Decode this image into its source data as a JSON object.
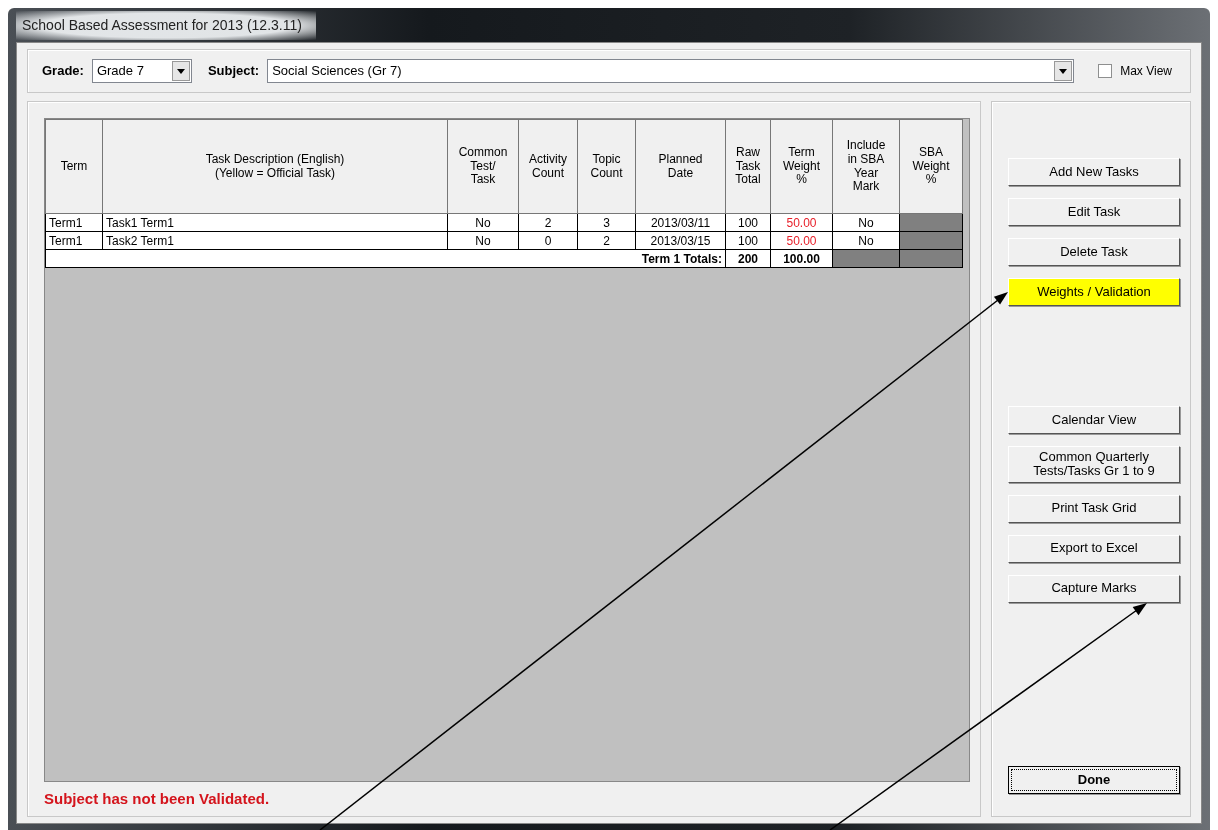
{
  "window": {
    "title": "School Based Assessment for 2013 (12.3.11)"
  },
  "filters": {
    "grade_label": "Grade:",
    "grade": "Grade 7",
    "subject_label": "Subject:",
    "subject": "Social Sciences (Gr 7)",
    "max_view": {
      "label": "Max View",
      "checked": false
    }
  },
  "table": {
    "columns": [
      "Term",
      "Task Description (English)\n(Yellow = Official Task)",
      "Common\nTest/\nTask",
      "Activity\nCount",
      "Topic\nCount",
      "Planned\nDate",
      "Raw\nTask\nTotal",
      "Term\nWeight\n%",
      "Include\nin SBA\nYear\nMark",
      "SBA\nWeight\n%"
    ],
    "rows": [
      {
        "cells": [
          "Term1",
          "Task1 Term1",
          "No",
          "2",
          "3",
          "2013/03/11",
          "100",
          "50.00",
          "No"
        ],
        "weight_flagged": true
      },
      {
        "cells": [
          "Term1",
          "Task2 Term1",
          "No",
          "0",
          "2",
          "2013/03/15",
          "100",
          "50.00",
          "No"
        ],
        "weight_flagged": true
      }
    ],
    "totals": {
      "label": "Term 1 Totals:",
      "raw_total": "200",
      "term_weight": "100.00"
    }
  },
  "status": "Subject has not been Validated.",
  "button_groups": [
    [
      {
        "label": "Add New Tasks",
        "highlighted": false,
        "default": false
      },
      {
        "label": "Edit Task",
        "highlighted": false,
        "default": false
      },
      {
        "label": "Delete Task",
        "highlighted": false,
        "default": false
      },
      {
        "label": "Weights / Validation",
        "highlighted": true,
        "default": false
      }
    ],
    [
      {
        "label": "Calendar View",
        "highlighted": false,
        "default": false
      },
      {
        "label": "Common Quarterly\nTests/Tasks Gr 1 to 9",
        "highlighted": false,
        "default": false
      },
      {
        "label": "Print Task Grid",
        "highlighted": false,
        "default": false
      },
      {
        "label": "Export to Excel",
        "highlighted": false,
        "default": false
      },
      {
        "label": "Capture Marks",
        "highlighted": false,
        "default": false
      }
    ],
    [
      {
        "label": "Done",
        "highlighted": false,
        "default": true
      }
    ]
  ]
}
